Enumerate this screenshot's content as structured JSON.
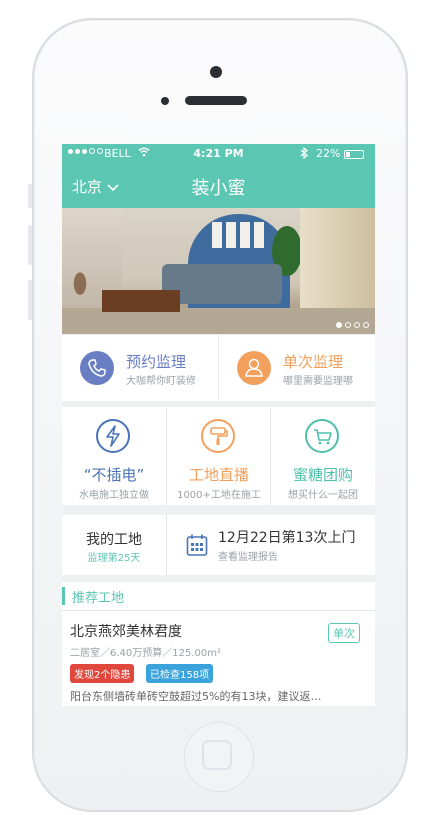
{
  "status_bar": {
    "carrier": "BELL",
    "time": "4:21 PM",
    "battery": "22%"
  },
  "nav": {
    "city": "北京",
    "title": "装小蜜"
  },
  "banner": {
    "pages": 4,
    "active_page": 1
  },
  "services_top": [
    {
      "title": "预约监理",
      "subtitle": "大咖帮你盯装修",
      "icon": "phone-icon",
      "color": "#6a7ec4"
    },
    {
      "title": "单次监理",
      "subtitle": "哪里需要监理哪",
      "icon": "person-icon",
      "color": "#f2a05c"
    }
  ],
  "services_grid": [
    {
      "title": "“不插电”",
      "subtitle": "水电施工独立做",
      "icon": "lightning-icon",
      "color": "#4a73b8"
    },
    {
      "title": "工地直播",
      "subtitle": "1000+工地在施工",
      "icon": "paint-roller-icon",
      "color": "#f2a05c"
    },
    {
      "title": "蜜糖团购",
      "subtitle": "想买什么一起团",
      "icon": "cart-icon",
      "color": "#4fbfaa"
    }
  ],
  "my_site": {
    "title": "我的工地",
    "subtitle": "监理第25天"
  },
  "schedule": {
    "title": "12月22日第13次上门",
    "subtitle": "查看监理报告"
  },
  "recommend": {
    "section_title": "推荐工地"
  },
  "site_card": {
    "name": "北京燕郊美林君度",
    "tag": "单次",
    "meta": "二居室／6.40万预算／125.00m²",
    "badge_issue": "发现2个隐患",
    "badge_checked": "已检查158项",
    "description": "阳台东侧墙砖单砖空鼓超过5%的有13块，建议返…"
  },
  "theme": {
    "accent": "#5bc6b2"
  }
}
